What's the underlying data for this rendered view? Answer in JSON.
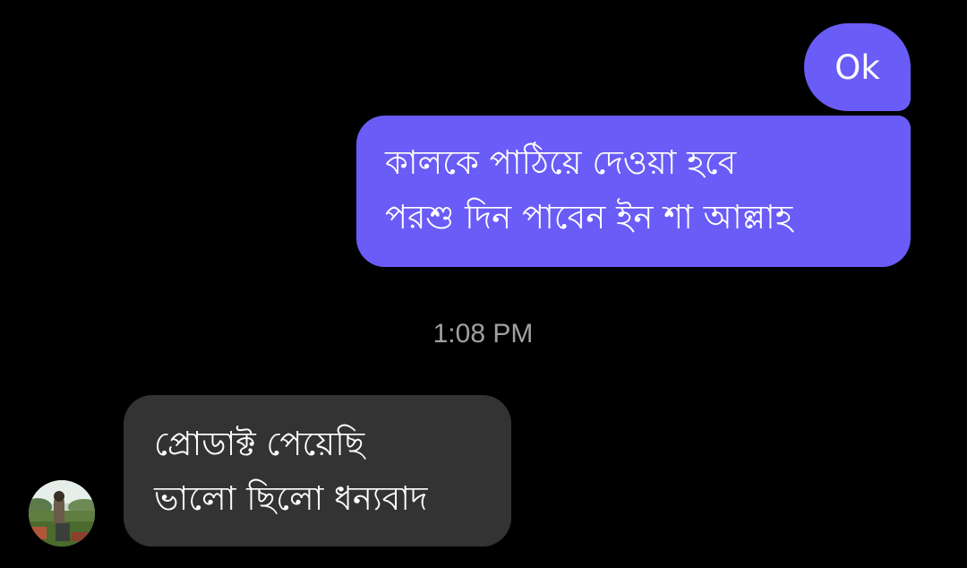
{
  "messages": [
    {
      "direction": "outgoing",
      "lines": [
        "Ok"
      ]
    },
    {
      "direction": "outgoing",
      "lines": [
        "কালকে পাঠিয়ে দেওয়া হবে",
        "পরশু দিন পাবেন ইন শা আল্লাহ"
      ]
    },
    {
      "direction": "incoming",
      "lines": [
        "প্রোডাক্ট পেয়েছি",
        "ভালো ছিলো ধন্যবাদ"
      ]
    }
  ],
  "timestamp": "1:08 PM",
  "colors": {
    "background": "#000000",
    "outgoing_bubble": "#6a5cf6",
    "incoming_bubble": "#333333",
    "timestamp_text": "#a0a0a0"
  },
  "icons": {
    "contact_avatar": "avatar-photo"
  }
}
